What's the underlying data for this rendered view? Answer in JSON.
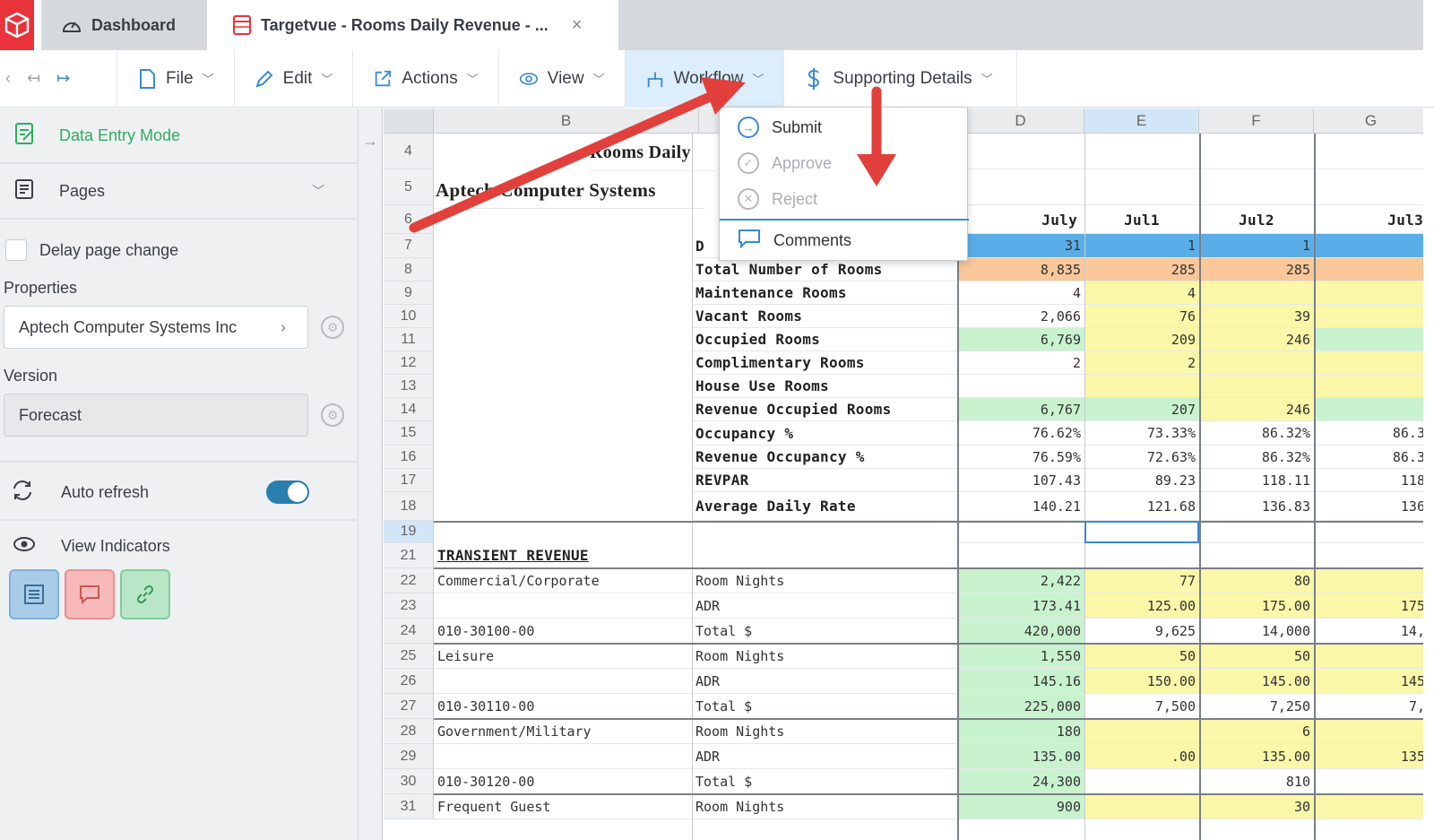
{
  "tabs": {
    "dashboard": "Dashboard",
    "active": "Targetvue - Rooms Daily Revenue - ...",
    "close": "×"
  },
  "toolbar": {
    "file": "File",
    "edit": "Edit",
    "actions": "Actions",
    "view": "View",
    "workflow": "Workflow",
    "supporting": "Supporting Details"
  },
  "workflow_menu": {
    "submit": "Submit",
    "approve": "Approve",
    "reject": "Reject",
    "comments": "Comments"
  },
  "sidebar": {
    "data_entry_mode": "Data Entry Mode",
    "pages": "Pages",
    "delay_page_change": "Delay page change",
    "properties_label": "Properties",
    "property_value": "Aptech Computer Systems Inc",
    "version_label": "Version",
    "version_value": "Forecast",
    "auto_refresh": "Auto refresh",
    "view_indicators": "View Indicators"
  },
  "grid": {
    "columns": [
      "B",
      "D",
      "E",
      "F",
      "G"
    ],
    "title": "Rooms Daily",
    "company": "Aptech Computer Systems",
    "rows": [
      {
        "n": "4"
      },
      {
        "n": "5"
      },
      {
        "n": "6"
      },
      {
        "n": "7",
        "label": "D",
        "d": "31",
        "e": "1",
        "f": "1",
        "g": ""
      },
      {
        "n": "8",
        "label": "Total Number of Rooms",
        "d": "8,835",
        "e": "285",
        "f": "285",
        "g": ""
      },
      {
        "n": "9",
        "label": "Maintenance Rooms",
        "d": "4",
        "e": "4",
        "f": "",
        "g": ""
      },
      {
        "n": "10",
        "label": "Vacant Rooms",
        "d": "2,066",
        "e": "76",
        "f": "39",
        "g": ""
      },
      {
        "n": "11",
        "label": "Occupied Rooms",
        "d": "6,769",
        "e": "209",
        "f": "246",
        "g": ""
      },
      {
        "n": "12",
        "label": "Complimentary Rooms",
        "d": "2",
        "e": "2",
        "f": "",
        "g": ""
      },
      {
        "n": "13",
        "label": "House Use Rooms",
        "d": "",
        "e": "",
        "f": "",
        "g": ""
      },
      {
        "n": "14",
        "label": "Revenue Occupied Rooms",
        "d": "6,767",
        "e": "207",
        "f": "246",
        "g": ""
      },
      {
        "n": "15",
        "label": "Occupancy %",
        "d": "76.62%",
        "e": "73.33%",
        "f": "86.32%",
        "g": "86.3"
      },
      {
        "n": "16",
        "label": "Revenue Occupancy %",
        "d": "76.59%",
        "e": "72.63%",
        "f": "86.32%",
        "g": "86.3"
      },
      {
        "n": "17",
        "label": "REVPAR",
        "d": "107.43",
        "e": "89.23",
        "f": "118.11",
        "g": "118"
      },
      {
        "n": "18",
        "label": "Average Daily Rate",
        "d": "140.21",
        "e": "121.68",
        "f": "136.83",
        "g": "136"
      },
      {
        "n": "19"
      },
      {
        "n": "21",
        "b": "TRANSIENT REVENUE"
      },
      {
        "n": "22",
        "b": "Commercial/Corporate",
        "c": "Room Nights",
        "d": "2,422",
        "e": "77",
        "f": "80",
        "g": ""
      },
      {
        "n": "23",
        "b": "",
        "c": "ADR",
        "d": "173.41",
        "e": "125.00",
        "f": "175.00",
        "g": "175"
      },
      {
        "n": "24",
        "b": "010-30100-00",
        "c": "Total $",
        "d": "420,000",
        "e": "9,625",
        "f": "14,000",
        "g": "14,"
      },
      {
        "n": "25",
        "b": "Leisure",
        "c": "Room Nights",
        "d": "1,550",
        "e": "50",
        "f": "50",
        "g": ""
      },
      {
        "n": "26",
        "b": "",
        "c": "ADR",
        "d": "145.16",
        "e": "150.00",
        "f": "145.00",
        "g": "145"
      },
      {
        "n": "27",
        "b": "010-30110-00",
        "c": "Total $",
        "d": "225,000",
        "e": "7,500",
        "f": "7,250",
        "g": "7,"
      },
      {
        "n": "28",
        "b": "Government/Military",
        "c": "Room Nights",
        "d": "180",
        "e": "",
        "f": "6",
        "g": ""
      },
      {
        "n": "29",
        "b": "",
        "c": "ADR",
        "d": "135.00",
        "e": ".00",
        "f": "135.00",
        "g": "135"
      },
      {
        "n": "30",
        "b": "010-30120-00",
        "c": "Total $",
        "d": "24,300",
        "e": "",
        "f": "810",
        "g": ""
      },
      {
        "n": "31",
        "b": "Frequent Guest",
        "c": "Room Nights",
        "d": "900",
        "e": "",
        "f": "30",
        "g": ""
      }
    ],
    "month_headers": {
      "d": "July",
      "e": "Jul1",
      "f": "Jul2",
      "g": "Jul3"
    }
  },
  "colors": {
    "accent": "#3b89d6",
    "brand_red": "#e8333a",
    "data_entry_green": "#2fae5f",
    "blue_row": "#5aaee8",
    "orange_row": "#f9c79a",
    "green_cell": "#c9f2cf",
    "yellow_cell": "#fbf7a9",
    "arrow_red": "#e2403c"
  }
}
